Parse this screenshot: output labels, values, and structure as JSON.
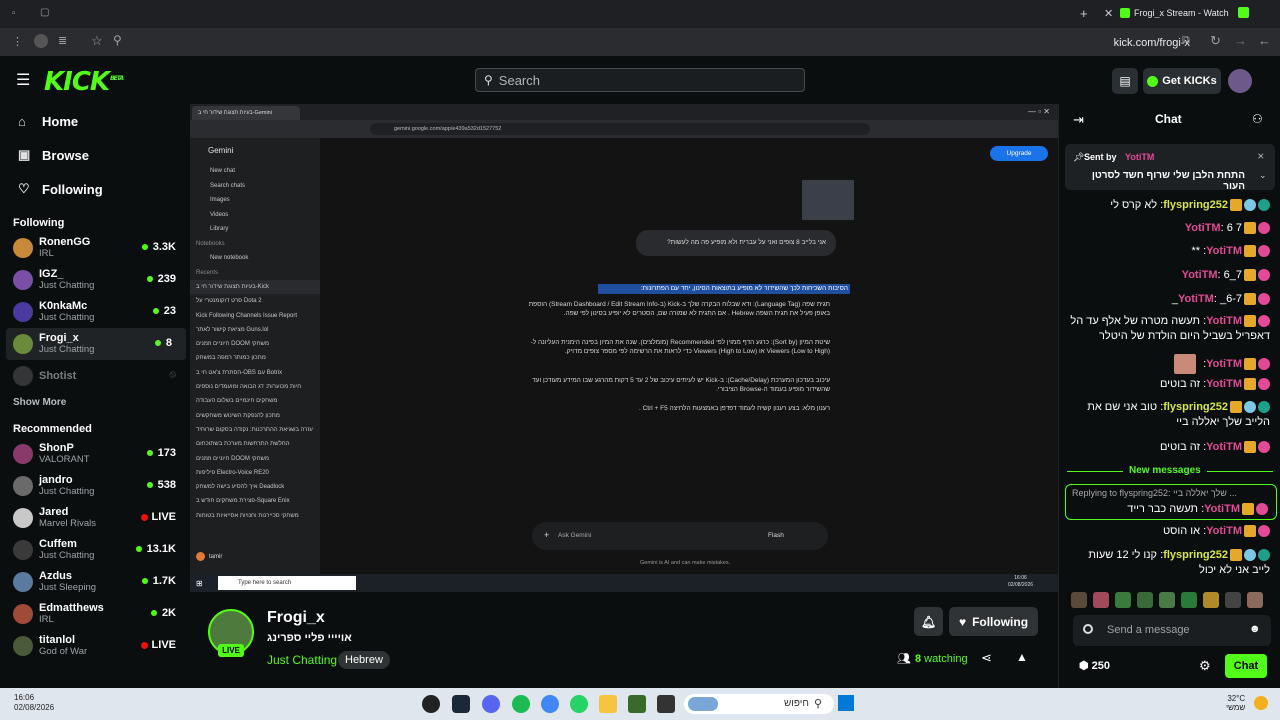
{
  "browser": {
    "tab_title": "Frogi_x Stream - Watch Liv...",
    "url": "kick.com/frogi-x"
  },
  "header": {
    "logo": "KICK",
    "logo_sup": "BETA",
    "search_placeholder": "Search",
    "get_kicks": "Get KICKs"
  },
  "sidebar": {
    "nav": [
      {
        "label": "Home",
        "icon": "home-icon"
      },
      {
        "label": "Browse",
        "icon": "browse-icon"
      },
      {
        "label": "Following",
        "icon": "heart-icon"
      }
    ],
    "following_title": "Following",
    "following": [
      {
        "name": "RonenGG",
        "sub": "IRL",
        "viewers": "3.3K",
        "color": "#c78a3a"
      },
      {
        "name": "IGZ_",
        "sub": "Just Chatting",
        "viewers": "239",
        "color": "#7b4fa6"
      },
      {
        "name": "K0nkaMc",
        "sub": "Just Chatting",
        "viewers": "23",
        "color": "#4a3aa0"
      },
      {
        "name": "Frogi_x",
        "sub": "Just Chatting",
        "viewers": "8",
        "color": "#6b8a3b"
      },
      {
        "name": "Shotist",
        "sub": "",
        "viewers": "",
        "color": "#666"
      }
    ],
    "show_more": "Show More",
    "recommended_title": "Recommended",
    "recommended": [
      {
        "name": "ShonP",
        "sub": "VALORANT",
        "viewers": "173",
        "live": false,
        "color": "#8a3a6a"
      },
      {
        "name": "jandro",
        "sub": "Just Chatting",
        "viewers": "538",
        "live": false,
        "color": "#6a6a6a"
      },
      {
        "name": "Jared",
        "sub": "Marvel Rivals",
        "viewers": "LIVE",
        "live": true,
        "color": "#c8c8c8"
      },
      {
        "name": "Cuffem",
        "sub": "Just Chatting",
        "viewers": "13.1K",
        "live": false,
        "color": "#3a3a3a"
      },
      {
        "name": "Azdus",
        "sub": "Just Sleeping",
        "viewers": "1.7K",
        "live": false,
        "color": "#5a7aa0"
      },
      {
        "name": "Edmatthews",
        "sub": "IRL",
        "viewers": "2K",
        "live": false,
        "color": "#a04a3a"
      },
      {
        "name": "titanlol",
        "sub": "God of War",
        "viewers": "LIVE",
        "live": true,
        "color": "#4a5a3a"
      }
    ]
  },
  "stream_screen": {
    "tab": "בעיות תצוגת שידור חי ב-Gemini",
    "address": "gemini.google.com/app/e439a532d1527752",
    "gemini": "Gemini",
    "upgrade": "Upgrade",
    "new_chat": "New chat",
    "search_chats": "Search chats",
    "images": "Images",
    "videos": "Videos",
    "library": "Library",
    "notebooks": "Notebooks",
    "new_notebook": "New notebook",
    "recents": "Recents",
    "recent_items": [
      "בעיות תצוגת שידור חי ב-Kick",
      "סרט דוקומנטרי על Dota 2",
      "Kick Following Channels Issue Report",
      "מציאת קישור לאתר Guns.lol",
      "חיוניים וזמנים DOOM משחקי",
      "מתכון כמותר רמפה במשחק",
      "הסתרת צ'אט חי ב-OBS עם Botrix",
      "חיות מכוערות: דג הבואה ומועמדים נוספים",
      "משחקים חינמיים בשלום העבודה",
      "מתכון להנפקת השינוש משחקשים",
      "עזרה בשגיאת ההתרכנות: נקודה בסקום שרוחיד",
      "החלשת התרחשות מערכת בשתוכחום",
      "חיוניים וזמנים DOOM משחקי",
      "פיליפות Electro-Voice RE20",
      "איך להסיע בישה למשחק Deadlock",
      "פצירת משחקים חודש ב-Square Enix",
      "משחקי סכיירנות וחנויות אסייאיות בטוחות"
    ],
    "user": "tamir",
    "question": "אני בלייב 8 צופים ואני על עברית ולא מופיע פה מה לעשות?",
    "answer_heading": "הסיבות השכיחות לכך שהשידור לא מופיע בתוצאות הסינון, יחד עם הפתרונות:",
    "answer_lines": [
      "תגית שפה (Language Tag): ודא שבלוח הבקרה שלך ב-Kick (ב-Stream Dashboard / Edit Stream Info) הוספת באופן פעיל את תגית השפה Hebrew . אם התגית לא שמורה שם, הסטרים לא יופיע בסינון לפי שפה.",
      "שיטת המיון (Sort by): כרגע הדף ממוין לפי Recommended (מומלצים). שנה את המיון בפינה הימנית העליונה ל-Viewers (Low to High) או Viewers (High to Low) כדי לראות את הרשימה לפי מספר צופים מדויק.",
      "עיכוב בעדכון המערכת (Cache/Delay): ב-Kick יש לעיתים עיכוב של 2 עד 5 דקות מהרגע שבו המידע מעודכן ועד שהשידור מופיע בעמוד ה-Browse הציבורי.",
      "רענון מלא: בצע רענון קשיח לעמוד דפדפן באמצעות הלחיצה Ctrl + F5 ."
    ],
    "ask_placeholder": "Ask Gemini",
    "flash": "Flash",
    "disclaimer": "Gemini is AI and can make mistakes.",
    "taskbar_search": "Type here to search",
    "taskbar_time": "16:06",
    "taskbar_date": "02/08/2026"
  },
  "streamer": {
    "name": "Frogi_x",
    "title": "אויייי פליי ספרינג",
    "category": "Just Chatting",
    "tag": "Hebrew",
    "live": "LIVE",
    "following_label": "Following",
    "watching_count": "8",
    "watching_label": "watching"
  },
  "chat": {
    "title": "Chat",
    "pinned_by_label": "Sent by",
    "pinned_by": "YotiTM",
    "pinned_text": "התחת הלבן שלי שרוף חשד לסרטן העור",
    "messages": [
      {
        "user": "flyspring252",
        "text": "לא קרס לי",
        "ucolor": "#d8e64a",
        "badges": [
          "blue",
          "bot",
          "crown"
        ]
      },
      {
        "user": "YotiTM",
        "text": "6 7",
        "ucolor": "#e14a95",
        "badges": [
          "pink",
          "crown"
        ]
      },
      {
        "user": "YotiTM",
        "text": "**",
        "ucolor": "#e14a95",
        "badges": [
          "pink",
          "crown"
        ]
      },
      {
        "user": "YotiTM",
        "text": "6_7",
        "ucolor": "#e14a95",
        "badges": [
          "pink",
          "crown"
        ]
      },
      {
        "user": "YotiTM",
        "text": "_6-7_",
        "ucolor": "#e14a95",
        "badges": [
          "pink",
          "crown"
        ]
      },
      {
        "user": "YotiTM",
        "text": "תעשה מטרה של אלף עד הל דאפריל בשביל היום הולדת של היטלר",
        "ucolor": "#e14a95",
        "badges": [
          "pink",
          "crown"
        ]
      },
      {
        "user": "YotiTM",
        "text": "",
        "ucolor": "#e14a95",
        "badges": [
          "pink",
          "crown"
        ]
      },
      {
        "user": "YotiTM",
        "text": "זה בוטים",
        "ucolor": "#e14a95",
        "badges": [
          "pink",
          "crown"
        ]
      },
      {
        "user": "flyspring252",
        "text": "טוב אני שם את הלייב שלך יאללה ביי",
        "ucolor": "#d8e64a",
        "badges": [
          "blue",
          "bot",
          "crown"
        ]
      },
      {
        "user": "YotiTM",
        "text": "זה בוטים",
        "ucolor": "#e14a95",
        "badges": [
          "pink",
          "crown"
        ]
      }
    ],
    "new_messages": "New messages",
    "reply_to": "Replying to flyspring252: שלך יאללה ביי ...",
    "reply_msg": {
      "user": "YotiTM",
      "text": "תעשה כבר רייד"
    },
    "after": [
      {
        "user": "YotiTM",
        "text": "או הוסט",
        "ucolor": "#e14a95",
        "badges": [
          "pink",
          "crown"
        ]
      },
      {
        "user": "flyspring252",
        "text": "קנו לי 12 שעות לייב אני לא יכול",
        "ucolor": "#d8e64a",
        "badges": [
          "blue",
          "bot",
          "crown"
        ]
      }
    ],
    "send_placeholder": "Send a message",
    "points": "250",
    "chat_button": "Chat"
  },
  "taskbar": {
    "time": "16:06",
    "date": "02/08/2026",
    "search": "חיפוש",
    "weather": "32°C",
    "weather_sub": "שמשי"
  }
}
